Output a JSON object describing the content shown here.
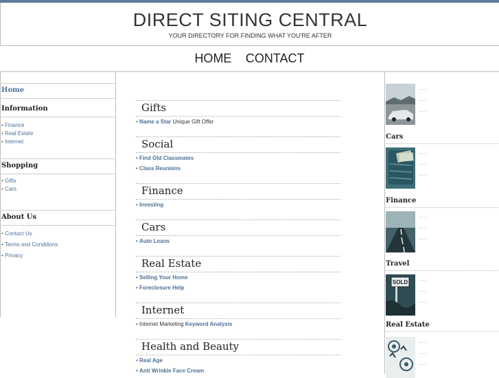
{
  "site": {
    "title": "DIRECT SITING CENTRAL",
    "tagline": "YOUR DIRECTORY FOR FINDING WHAT YOU'RE AFTER"
  },
  "topnav": {
    "home": "HOME",
    "contact": "CONTACT"
  },
  "left": {
    "home": "Home",
    "sections": [
      {
        "heading": "Information",
        "items": [
          "Finance",
          "Real Estate",
          "Internet"
        ]
      },
      {
        "heading": "Shopping",
        "items": [
          "Gifts",
          "Cars"
        ]
      },
      {
        "heading": "About Us",
        "items": [
          "Contact Us",
          "Terms and Conditions",
          "Privacy"
        ]
      }
    ]
  },
  "bullet": "•",
  "categories": [
    {
      "title": "Gifts",
      "links": [
        {
          "link": "Name a Star",
          "after": "Unique Gift Offer"
        }
      ]
    },
    {
      "title": "Social",
      "links": [
        {
          "link": "Find Old Classmates"
        },
        {
          "link": "Class Reunions"
        }
      ]
    },
    {
      "title": "Finance",
      "links": [
        {
          "link": "Investing"
        }
      ]
    },
    {
      "title": "Cars",
      "links": [
        {
          "link": "Auto Loans"
        }
      ]
    },
    {
      "title": "Real Estate",
      "links": [
        {
          "link": "Selling Your Home"
        },
        {
          "link": "Foreclosure Help"
        }
      ]
    },
    {
      "title": "Internet",
      "links": [
        {
          "before": "Internet Marketing",
          "link": "Keyword Analysis"
        }
      ]
    },
    {
      "title": "Health and Beauty",
      "links": [
        {
          "link": "Real Age"
        },
        {
          "link": "Anti Wrinkle Face Cream"
        }
      ]
    }
  ],
  "right": {
    "labels": [
      "Cars",
      "Finance",
      "Travel",
      "Real Estate"
    ],
    "thumb_icons": [
      "car-thumbnail",
      "money-thumbnail",
      "road-thumbnail",
      "sold-sign-thumbnail",
      "at-sign-thumbnail"
    ]
  },
  "colors": {
    "link": "#4d7096",
    "topbar": "#5d7d9a",
    "border": "#bbbbbb"
  }
}
